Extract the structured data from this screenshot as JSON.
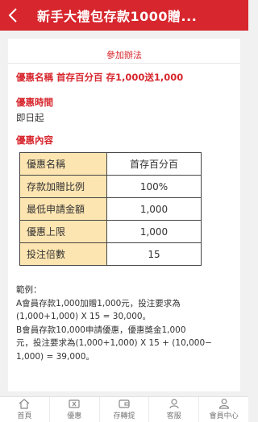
{
  "header": {
    "title": "新手大禮包存款1000贈..."
  },
  "section": {
    "title": "參加辦法"
  },
  "offer": {
    "name_line": "優惠名稱  首存百分百 存1,000送1,000"
  },
  "time": {
    "label": "優惠時間",
    "value": "即日起"
  },
  "details": {
    "label": "優惠內容",
    "rows": [
      {
        "key": "優惠名稱",
        "value": "首存百分百"
      },
      {
        "key": "存款加贈比例",
        "value": "100%"
      },
      {
        "key": "最低申請金額",
        "value": "1,000"
      },
      {
        "key": "優惠上限",
        "value": "1,000"
      },
      {
        "key": "投注倍數",
        "value": "15"
      }
    ]
  },
  "example": {
    "label": "範例：",
    "lines": [
      "A會員存款1,000加贈1,000元，投注要求為",
      "(1,000+1,000) X 15 = 30,000。",
      "B會員存款10,000申請優惠，優惠獎金1,000",
      "元，投注要求為(1,000+1,000) X 15 + (10,000−",
      "1,000) = 39,000。"
    ]
  },
  "tabbar": {
    "tabs": [
      {
        "label": "首頁",
        "icon": "home-icon"
      },
      {
        "label": "優惠",
        "icon": "gift-ticket-icon"
      },
      {
        "label": "存轉提",
        "icon": "wallet-icon"
      },
      {
        "label": "客服",
        "icon": "support-icon"
      },
      {
        "label": "會員中心",
        "icon": "user-icon"
      }
    ]
  },
  "colors": {
    "brand": "#d7262d",
    "table_key_bg": "#fde5b1"
  }
}
